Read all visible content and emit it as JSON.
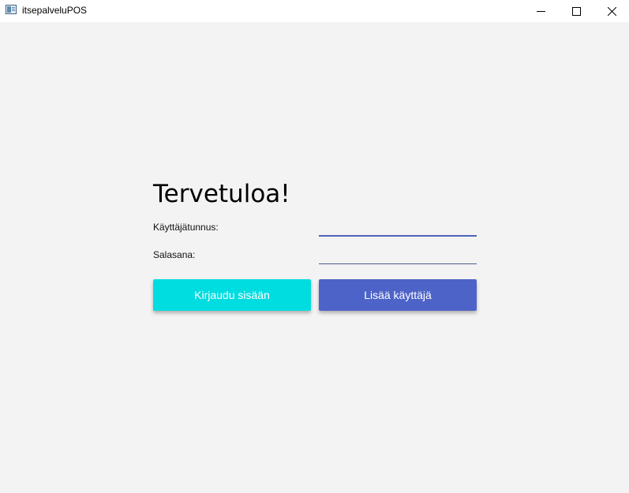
{
  "window": {
    "title": "itsepalveluPOS",
    "controls": [
      "minimize-icon",
      "maximize-icon",
      "close-icon"
    ]
  },
  "login": {
    "heading": "Tervetuloa!",
    "username_label": "Käyttäjätunnus:",
    "username_value": "",
    "password_label": "Salasana:",
    "password_value": "",
    "login_button": "Kirjaudu sisään",
    "add_user_button": "Lisää käyttäjä"
  },
  "colors": {
    "background": "#f3f3f3",
    "login_button": "#00dde0",
    "add_user_button": "#4d63c8",
    "field_underline": "#4f63b6"
  }
}
